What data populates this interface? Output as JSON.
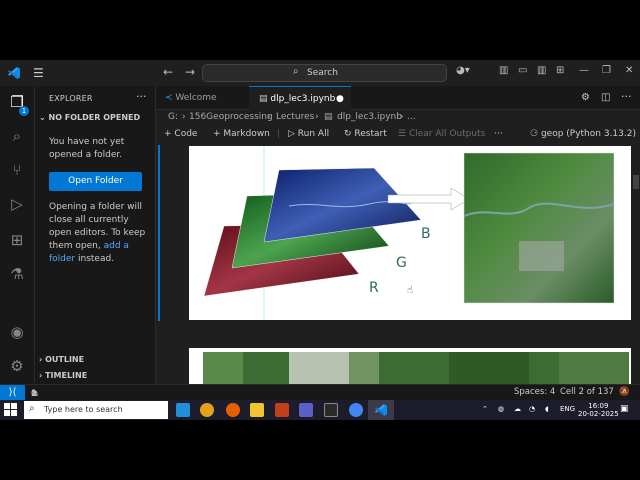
{
  "titlebar": {
    "search_label": "Search"
  },
  "sidebar": {
    "header": "EXPLORER",
    "section_title": "NO FOLDER OPENED",
    "message1": "You have not yet opened a folder.",
    "open_folder_label": "Open Folder",
    "message2_pre": "Opening a folder will close all currently open editors. To keep them open, ",
    "message2_link": "add a folder",
    "message2_post": " instead.",
    "outline_label": "OUTLINE",
    "timeline_label": "TIMELINE",
    "explorer_badge": "1"
  },
  "tabs": [
    {
      "label": "Welcome"
    },
    {
      "label": "dlp_lec3.ipynb"
    }
  ],
  "breadcrumb": {
    "drive": "G:",
    "folder1": "156Geoprocessing",
    "folder2": "Lectures",
    "file": "dlp_lec3.ipynb",
    "more": "..."
  },
  "toolbar": {
    "code_label": "Code",
    "markdown_label": "Markdown",
    "run_all_label": "Run All",
    "restart_label": "Restart",
    "clear_outputs_label": "Clear All Outputs",
    "kernel_label": "geop (Python 3.13.2)"
  },
  "figure": {
    "band_b": "B",
    "band_g": "G",
    "band_r": "R"
  },
  "status": {
    "errors": "0",
    "warnings": "1",
    "spaces": "Spaces: 4",
    "cell": "Cell 2 of 137"
  },
  "taskbar": {
    "search_placeholder": "Type here to search",
    "lang": "ENG",
    "time": "16:09",
    "date": "20-02-2025"
  },
  "colors": {
    "accent": "#0078d4",
    "activity_bg": "#181818",
    "editor_bg": "#1f1f1f"
  }
}
